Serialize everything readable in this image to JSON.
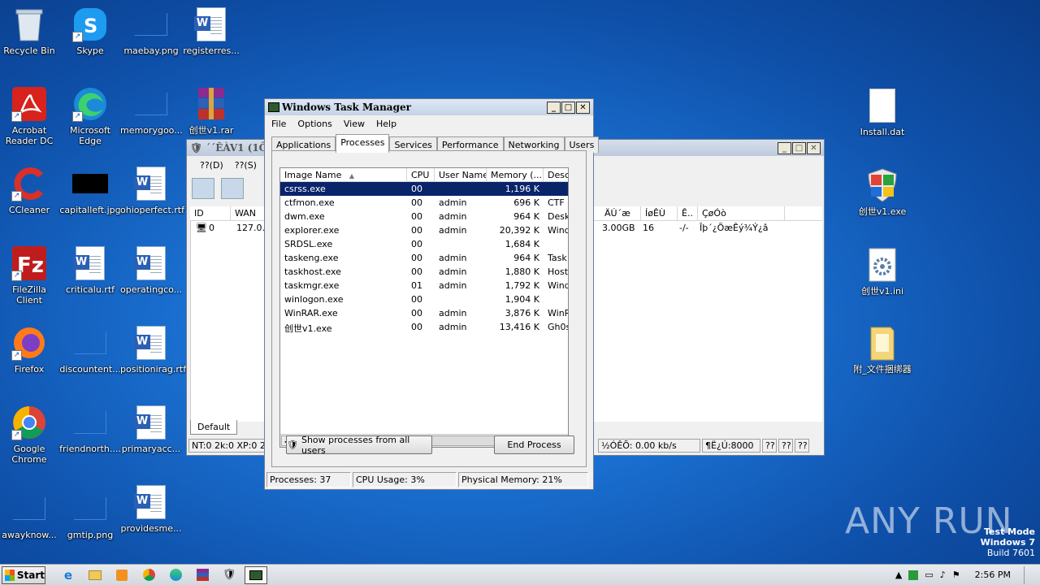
{
  "desktop_icons": [
    {
      "label": "Recycle Bin"
    },
    {
      "label": "Skype"
    },
    {
      "label": "maebay.png"
    },
    {
      "label": "registerres..."
    },
    {
      "label": "Acrobat Reader DC"
    },
    {
      "label": "Microsoft Edge"
    },
    {
      "label": "memorygoo..."
    },
    {
      "label": "创世v1.rar"
    },
    {
      "label": "CCleaner"
    },
    {
      "label": "capitalleft.jpg"
    },
    {
      "label": "ohioperfect.rtf"
    },
    {
      "label": "FileZilla Client"
    },
    {
      "label": "criticalu.rtf"
    },
    {
      "label": "operatingco..."
    },
    {
      "label": "Firefox"
    },
    {
      "label": "discountent..."
    },
    {
      "label": "positionirag.rtf"
    },
    {
      "label": "Google Chrome"
    },
    {
      "label": "friendnorth...."
    },
    {
      "label": "primaryacc..."
    },
    {
      "label": "awayknow..."
    },
    {
      "label": "gmtip.png"
    },
    {
      "label": "providesme..."
    },
    {
      "label": "Install.dat"
    },
    {
      "label": "创世v1.exe"
    },
    {
      "label": "创世v1.ini"
    },
    {
      "label": "附_文件捆绑器"
    }
  ],
  "background_window": {
    "title": "´´ÊÀV1 (1ÔÂ",
    "menu": [
      "??(D)",
      "??(S)"
    ],
    "columns": [
      "ID",
      "WAN",
      "ÄÚ´æ",
      "ÍøÊÙ",
      "Ê..",
      "ÇøÓò"
    ],
    "row": {
      "id": "0",
      "wan": "127.0.0",
      "mem": "3.00GB",
      "net": "16",
      "e": "-/-",
      "region": "Îþ´¿ÕæÊý¾Ý¿â"
    },
    "tab": "Default",
    "status": {
      "left": "NT:0 2k:0 XP:0 2k3",
      "speed": "½ÓÊÕ: 0.00 kb/s",
      "port": "¶Ë¿Ú:8000",
      "q1": "??",
      "q2": "??",
      "q3": "??"
    }
  },
  "task_manager": {
    "title": "Windows Task Manager",
    "menu": [
      "File",
      "Options",
      "View",
      "Help"
    ],
    "tabs": [
      "Applications",
      "Processes",
      "Services",
      "Performance",
      "Networking",
      "Users"
    ],
    "active_tab": "Processes",
    "columns": [
      "Image Name",
      "CPU",
      "User Name",
      "Memory (...",
      "Desc"
    ],
    "processes": [
      {
        "name": "csrss.exe",
        "cpu": "00",
        "user": "",
        "mem": "1,196 K",
        "desc": "",
        "selected": true
      },
      {
        "name": "ctfmon.exe",
        "cpu": "00",
        "user": "admin",
        "mem": "696 K",
        "desc": "CTF L"
      },
      {
        "name": "dwm.exe",
        "cpu": "00",
        "user": "admin",
        "mem": "964 K",
        "desc": "Deskt"
      },
      {
        "name": "explorer.exe",
        "cpu": "00",
        "user": "admin",
        "mem": "20,392 K",
        "desc": "Wind"
      },
      {
        "name": "SRDSL.exe",
        "cpu": "00",
        "user": "",
        "mem": "1,684 K",
        "desc": ""
      },
      {
        "name": "taskeng.exe",
        "cpu": "00",
        "user": "admin",
        "mem": "964 K",
        "desc": "Task"
      },
      {
        "name": "taskhost.exe",
        "cpu": "00",
        "user": "admin",
        "mem": "1,880 K",
        "desc": "Host"
      },
      {
        "name": "taskmgr.exe",
        "cpu": "01",
        "user": "admin",
        "mem": "1,792 K",
        "desc": "Wind"
      },
      {
        "name": "winlogon.exe",
        "cpu": "00",
        "user": "",
        "mem": "1,904 K",
        "desc": ""
      },
      {
        "name": "WinRAR.exe",
        "cpu": "00",
        "user": "admin",
        "mem": "3,876 K",
        "desc": "WinR"
      },
      {
        "name": "创世v1.exe",
        "cpu": "00",
        "user": "admin",
        "mem": "13,416 K",
        "desc": "Gh0s"
      }
    ],
    "show_all_label": "Show processes from all users",
    "end_process_label": "End Process",
    "status": {
      "processes": "Processes: 37",
      "cpu": "CPU Usage: 3%",
      "memory": "Physical Memory: 21%"
    }
  },
  "taskbar": {
    "start_label": "Start",
    "clock": "2:56 PM"
  },
  "watermark": "ANY RUN",
  "test_mode": {
    "line1": "Test Mode",
    "line2": "Windows 7",
    "line3": "Build 7601"
  }
}
